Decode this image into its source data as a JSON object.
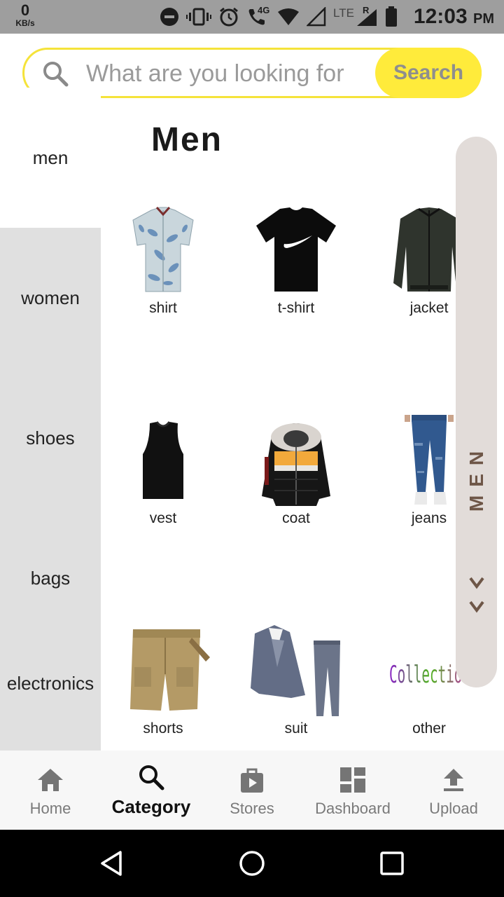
{
  "status_bar": {
    "speed_value": "0",
    "speed_unit": "KB/s",
    "network_4g": "4G",
    "network_lte": "LTE",
    "roaming": "R",
    "time": "12:03",
    "ampm": "PM"
  },
  "search": {
    "placeholder": "What are you looking for",
    "button_label": "Search",
    "accent_color": "#ffeb3b"
  },
  "categories": [
    {
      "label": "men",
      "active": true
    },
    {
      "label": "women",
      "active": false
    },
    {
      "label": "shoes",
      "active": false
    },
    {
      "label": "bags",
      "active": false
    },
    {
      "label": "electronics",
      "active": false
    }
  ],
  "content": {
    "title": "Men",
    "products": [
      {
        "label": "shirt",
        "icon": "shirt-image"
      },
      {
        "label": "t-shirt",
        "icon": "tshirt-image"
      },
      {
        "label": "jacket",
        "icon": "jacket-image"
      },
      {
        "label": "vest",
        "icon": "vest-image"
      },
      {
        "label": "coat",
        "icon": "coat-image"
      },
      {
        "label": "jeans",
        "icon": "jeans-image"
      },
      {
        "label": "shorts",
        "icon": "shorts-image"
      },
      {
        "label": "suit",
        "icon": "suit-image"
      },
      {
        "label": "other",
        "icon": "collection-image",
        "image_text": "Collection"
      }
    ]
  },
  "side_index": {
    "label": "MEN",
    "color": "#6e5647"
  },
  "bottom_nav": [
    {
      "label": "Home",
      "icon": "home-icon",
      "active": false
    },
    {
      "label": "Category",
      "icon": "search-icon",
      "active": true
    },
    {
      "label": "Stores",
      "icon": "store-icon",
      "active": false
    },
    {
      "label": "Dashboard",
      "icon": "dashboard-icon",
      "active": false
    },
    {
      "label": "Upload",
      "icon": "upload-icon",
      "active": false
    }
  ]
}
